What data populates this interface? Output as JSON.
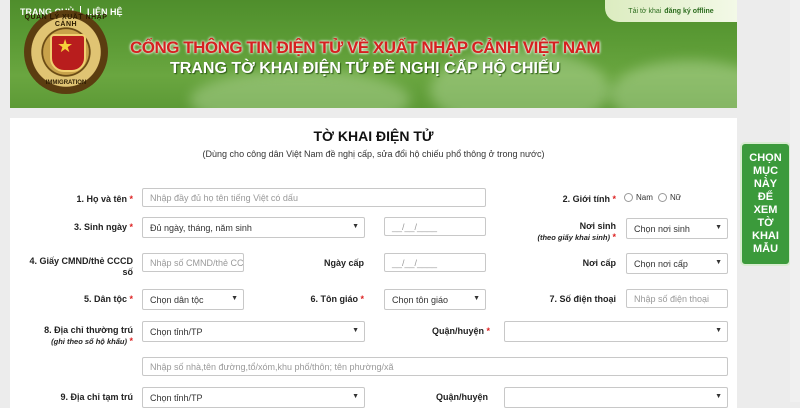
{
  "nav": {
    "home": "TRANG CHỦ",
    "contact": "LIÊN HỆ"
  },
  "offline": {
    "prefix": "Tải tờ khai",
    "link": "đăng ký offline"
  },
  "emblem": {
    "top_text": "QUẢN LÝ XUẤT NHẬP CẢNH",
    "bottom_text": "IMMIGRATION"
  },
  "header": {
    "title": "CỔNG THÔNG TIN ĐIỆN TỬ VỀ XUẤT NHẬP CẢNH VIỆT NAM",
    "subtitle": "TRANG TỜ KHAI ĐIỆN TỬ ĐỀ NGHỊ CẤP HỘ CHIẾU"
  },
  "form": {
    "title": "TỜ KHAI ĐIỆN TỬ",
    "subtitle": "(Dùng cho công dân Việt Nam đề nghị cấp, sửa đổi hộ chiếu phổ thông ở trong nước)",
    "fullname": {
      "label": "1. Họ và tên",
      "placeholder": "Nhập đầy đủ họ tên tiếng Việt có dấu"
    },
    "gender": {
      "label": "2. Giới tính",
      "male": "Nam",
      "female": "Nữ"
    },
    "dob": {
      "label": "3. Sinh ngày",
      "select": "Đủ ngày, tháng, năm sinh",
      "date_placeholder": "__/__/____"
    },
    "birthplace": {
      "label": "Nơi sinh",
      "note": "(theo giấy khai sinh)",
      "select": "Chọn nơi sinh"
    },
    "idcard": {
      "label_line1": "4. Giấy CMND/thẻ CCCD",
      "label_line2": "số",
      "placeholder": "Nhập số CMND/thẻ CCC"
    },
    "issue_date": {
      "label": "Ngày cấp",
      "placeholder": "__/__/____"
    },
    "issue_place": {
      "label": "Nơi cấp",
      "select": "Chọn nơi cấp"
    },
    "ethnic": {
      "label": "5. Dân tộc",
      "select": "Chọn dân tộc"
    },
    "religion": {
      "label": "6. Tôn giáo",
      "select": "Chọn tôn giáo"
    },
    "phone": {
      "label": "7. Số điện thoại",
      "placeholder": "Nhập số điện thoại"
    },
    "permanent_address": {
      "label": "8. Địa chỉ thường trú",
      "note": "(ghi theo sổ hộ khẩu)",
      "province": "Chọn tỉnh/TP",
      "district_label": "Quận/huyện",
      "street_placeholder": "Nhập số nhà,tên đường,tổ/xóm,khu phố/thôn; tên phường/xã"
    },
    "temp_address": {
      "label": "9. Địa chỉ tạm trú",
      "province": "Chọn tỉnh/TP",
      "district_label": "Quận/huyện"
    }
  },
  "side_button": {
    "lines": [
      "CHỌN",
      "MỤC",
      "NÀY",
      "ĐỂ",
      "XEM",
      "TỜ",
      "KHAI",
      "MẪU"
    ]
  },
  "colors": {
    "header_green": "#5a9a34",
    "title_red": "#d62020",
    "side_button": "#3b9a3b",
    "required": "#dd2222"
  }
}
